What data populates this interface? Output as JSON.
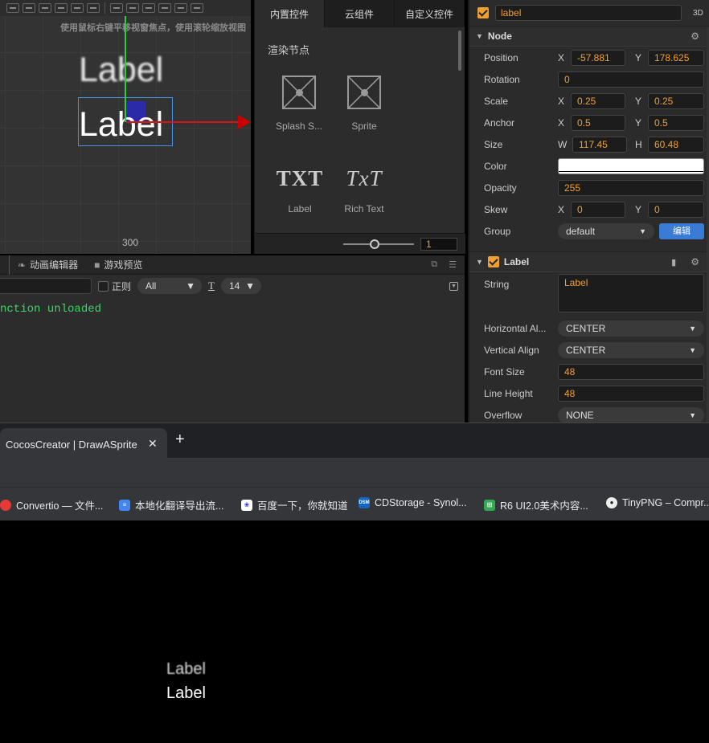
{
  "scene": {
    "hint": "使用鼠标右键平移视窗焦点，使用滚轮缩放视图",
    "label_blurry": "Label",
    "label_sharp": "Label",
    "ruler_value": "300"
  },
  "library": {
    "tabs": [
      "内置控件",
      "云组件",
      "自定义控件"
    ],
    "section": "渲染节点",
    "items": {
      "splash": "Splash S...",
      "sprite": "Sprite",
      "label": "Label",
      "label_icon": "TXT",
      "richtext": "Rich Text",
      "richtext_icon": "TxT"
    },
    "zoom_value": "1"
  },
  "console": {
    "tabs": {
      "animation": "动画编辑器",
      "preview": "游戏预览"
    },
    "regex_label": "正则",
    "level": "All",
    "font_icon": "T",
    "font_size": "14",
    "log_line": "nction unloaded"
  },
  "inspector": {
    "node_name": "label",
    "mode_3d": "3D",
    "node_section": "Node",
    "position_label": "Position",
    "position_x": "-57.881",
    "position_y": "178.625",
    "rotation_label": "Rotation",
    "rotation": "0",
    "scale_label": "Scale",
    "scale_x": "0.25",
    "scale_y": "0.25",
    "anchor_label": "Anchor",
    "anchor_x": "0.5",
    "anchor_y": "0.5",
    "size_label": "Size",
    "size_w": "117.45",
    "size_h": "60.48",
    "color_label": "Color",
    "opacity_label": "Opacity",
    "opacity": "255",
    "skew_label": "Skew",
    "skew_x": "0",
    "skew_y": "0",
    "group_label": "Group",
    "group": "default",
    "group_edit": "编辑",
    "axis_x": "X",
    "axis_y": "Y",
    "axis_w": "W",
    "axis_h": "H",
    "label_section": "Label",
    "string_label": "String",
    "string": "Label",
    "halign_label": "Horizontal Al...",
    "halign": "CENTER",
    "valign_label": "Vertical Align",
    "valign": "CENTER",
    "fontsize_label": "Font Size",
    "fontsize": "48",
    "lineheight_label": "Line Height",
    "lineheight": "48",
    "overflow_label": "Overflow",
    "overflow": "NONE"
  },
  "browser": {
    "tab_title": "CocosCreator | DrawASprite",
    "close_glyph": "✕",
    "newtab_glyph": "+",
    "bookmarks": [
      "Convertio — 文件...",
      "本地化翻译导出流...",
      "百度一下，你就知道",
      "CDStorage - Synol...",
      "R6 UI2.0美术内容...",
      "TinyPNG – Compr..."
    ]
  },
  "preview": {
    "label_blurry": "Label",
    "label_sharp": "Label"
  }
}
